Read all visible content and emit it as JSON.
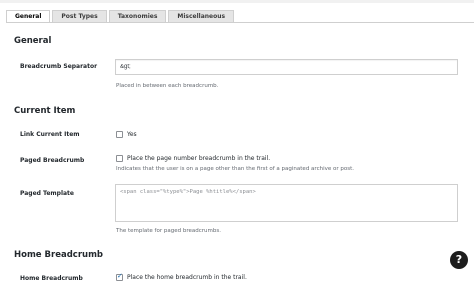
{
  "tabs": [
    {
      "label": "General",
      "active": true
    },
    {
      "label": "Post Types",
      "active": false
    },
    {
      "label": "Taxonomies",
      "active": false
    },
    {
      "label": "Miscellaneous",
      "active": false
    }
  ],
  "sections": {
    "general": {
      "title": "General"
    },
    "current_item": {
      "title": "Current Item"
    },
    "home_breadcrumb": {
      "title": "Home Breadcrumb"
    }
  },
  "fields": {
    "separator": {
      "label": "Breadcrumb Separator",
      "value": "&gt;",
      "description": "Placed in between each breadcrumb."
    },
    "link_current_item": {
      "label": "Link Current Item",
      "checkbox_label": "Yes",
      "checked": false
    },
    "paged_breadcrumb": {
      "label": "Paged Breadcrumb",
      "checkbox_label": "Place the page number breadcrumb in the trail.",
      "checked": false,
      "description": "Indicates that the user is on a page other than the first of a paginated archive or post."
    },
    "paged_template": {
      "label": "Paged Template",
      "value": "<span class=\"%type%\">Page %htitle%</span>",
      "description": "The template for paged breadcrumbs."
    },
    "home_breadcrumb": {
      "label": "Home Breadcrumb",
      "checkbox_label": "Place the home breadcrumb in the trail.",
      "checked": true
    }
  },
  "help_button": {
    "label": "?"
  }
}
